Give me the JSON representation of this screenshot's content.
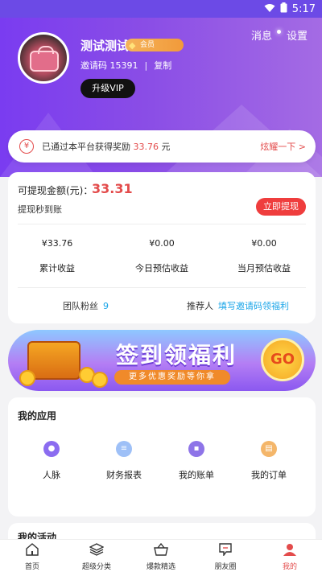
{
  "status_bar": {
    "time": "5:17"
  },
  "header": {
    "messages": "消息",
    "settings": "设置"
  },
  "profile": {
    "name": "测试测试",
    "vip_badge": "会员",
    "invite_label": "邀请码",
    "invite_code": "15391",
    "copy": "复制",
    "upgrade": "升级VIP"
  },
  "reward": {
    "prefix": "已通过本平台获得奖励",
    "amount": "33.76",
    "suffix": "元",
    "link": "炫耀一下 >"
  },
  "earnings": {
    "withdraw_label": "可提现金额(元)：",
    "withdraw_amount": "33.31",
    "withdraw_sub": "提现秒到账",
    "withdraw_button": "立即提现",
    "stats": [
      {
        "value": "¥33.76",
        "label": "累计收益"
      },
      {
        "value": "¥0.00",
        "label": "今日预估收益"
      },
      {
        "value": "¥0.00",
        "label": "当月预估收益"
      }
    ],
    "team_label": "团队粉丝",
    "team_count": "9",
    "referrer_label": "推荐人",
    "referrer_link": "填写邀请码领福利"
  },
  "banner": {
    "title": "签到领福利",
    "subtitle": "更多优惠奖励等你拿",
    "go": "GO"
  },
  "apps": {
    "title": "我的应用",
    "items": [
      {
        "label": "人脉",
        "icon": "contacts-icon",
        "color": "#8b6cf0"
      },
      {
        "label": "财务报表",
        "icon": "report-icon",
        "color": "#9ec0f7"
      },
      {
        "label": "我的账单",
        "icon": "bill-icon",
        "color": "#8e74e8"
      },
      {
        "label": "我的订单",
        "icon": "order-icon",
        "color": "#f4b66a"
      }
    ]
  },
  "activity": {
    "title": "我的活动"
  },
  "tabbar": [
    {
      "label": "首页",
      "icon": "home-icon"
    },
    {
      "label": "超级分类",
      "icon": "layers-icon"
    },
    {
      "label": "爆款精选",
      "icon": "basket-icon"
    },
    {
      "label": "朋友圈",
      "icon": "moments-icon"
    },
    {
      "label": "我的",
      "icon": "user-icon",
      "active": true
    }
  ],
  "colors": {
    "accent": "#e34b4b",
    "brand_purple": "#7a3cf0",
    "link_blue": "#1aa5e8"
  }
}
